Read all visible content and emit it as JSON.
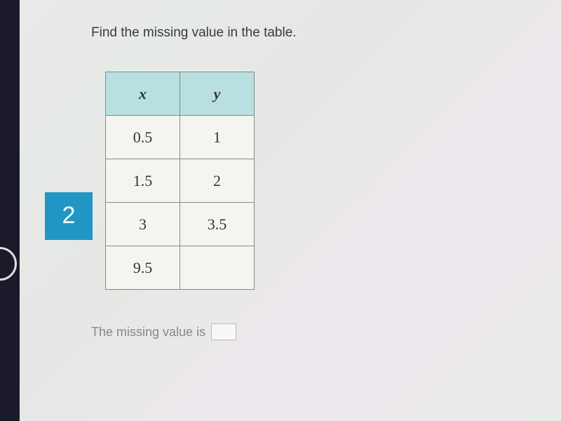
{
  "instruction": "Find the missing value in the table.",
  "badge": "2",
  "chart_data": {
    "type": "table",
    "title": "",
    "columns": [
      "x",
      "y"
    ],
    "rows": [
      {
        "x": "0.5",
        "y": "1"
      },
      {
        "x": "1.5",
        "y": "2"
      },
      {
        "x": "3",
        "y": "3.5"
      },
      {
        "x": "9.5",
        "y": ""
      }
    ]
  },
  "answer_prompt": "The missing value is"
}
